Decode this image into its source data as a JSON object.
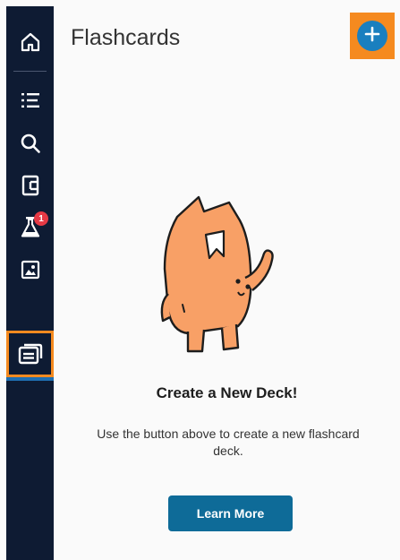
{
  "sidebar": {
    "items": [
      {
        "icon": "home-icon"
      },
      {
        "icon": "list-icon"
      },
      {
        "icon": "search-icon"
      },
      {
        "icon": "document-icon"
      },
      {
        "icon": "flask-icon",
        "badge": "1"
      },
      {
        "icon": "image-icon"
      },
      {
        "icon": "flashcards-icon",
        "active": true
      }
    ],
    "background": "#0e1b33",
    "highlight_color": "#f58a1f",
    "badge_color": "#e53945"
  },
  "header": {
    "title": "Flashcards",
    "add_button_icon": "plus-icon",
    "add_button_color": "#1a7fbf"
  },
  "empty_state": {
    "illustration": "orange-mascot-illustration",
    "heading": "Create a New Deck!",
    "description": "Use the button above to create a new flashcard deck.",
    "learn_more_label": "Learn More",
    "button_color": "#0e6b98"
  }
}
